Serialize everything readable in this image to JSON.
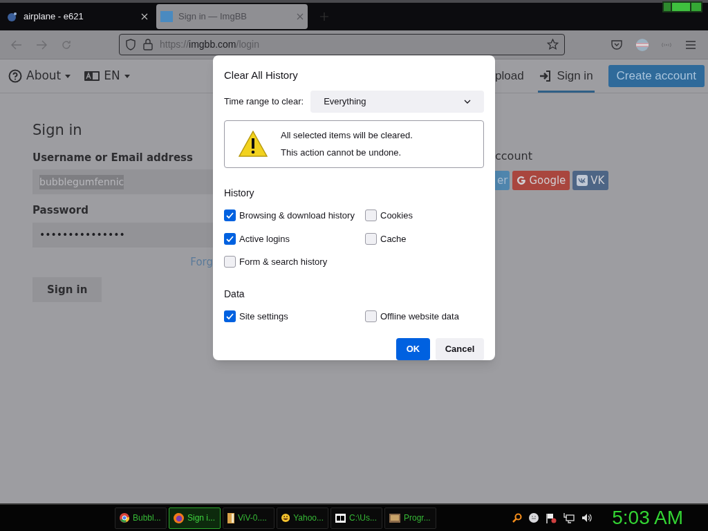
{
  "browser_tabs": [
    {
      "title": "airplane - e621",
      "selected": false
    },
    {
      "title": "Sign in — ImgBB",
      "selected": true
    }
  ],
  "address_bar": {
    "url_scheme": "https://",
    "url_domain": "imgbb.com",
    "url_path": "/login"
  },
  "site_header": {
    "menus": [
      {
        "label": "About"
      },
      {
        "label": "EN"
      }
    ],
    "links": [
      {
        "label": "pload",
        "selected": false
      },
      {
        "label": "Sign in",
        "selected": true
      }
    ],
    "create_account": "Create account"
  },
  "sign_in": {
    "title": "Sign in",
    "username_label": "Username or Email address",
    "username_value": "bubblegumfennic",
    "username_highlighted": true,
    "password_label": "Password",
    "password_value": "•••••••••••••••",
    "forgot_link": "Forg",
    "button": "Sign in"
  },
  "social": {
    "title": "ccount",
    "buttons": [
      {
        "label": "er",
        "color": "#4f85ad"
      },
      {
        "label": "Google",
        "color": "#a9463e"
      },
      {
        "label": "VK",
        "color": "#4d6585"
      }
    ]
  },
  "dialog": {
    "title": "Clear All History",
    "time_range_label": "Time range to clear:",
    "time_range_value": "Everything",
    "warning_lines": [
      "All selected items will be cleared.",
      "This action cannot be undone."
    ],
    "sections": [
      {
        "title": "History",
        "items": [
          {
            "label": "Browsing & download history",
            "checked": true
          },
          {
            "label": "Cookies",
            "checked": false
          },
          {
            "label": "Active logins",
            "checked": true
          },
          {
            "label": "Cache",
            "checked": false
          },
          {
            "label": "Form & search history",
            "checked": false
          }
        ]
      },
      {
        "title": "Data",
        "items": [
          {
            "label": "Site settings",
            "checked": true
          },
          {
            "label": "Offline website data",
            "checked": false
          }
        ]
      }
    ],
    "ok": "OK",
    "cancel": "Cancel"
  },
  "taskbar": {
    "items": [
      {
        "label": "Bubbl...",
        "selected": false
      },
      {
        "label": "Sign i...",
        "selected": true
      },
      {
        "label": "ViV-0....",
        "selected": false
      },
      {
        "label": "Yahoo...",
        "selected": false
      },
      {
        "label": "C:\\Us...",
        "selected": false
      },
      {
        "label": "Progr...",
        "selected": false
      }
    ],
    "clock": "5:03 AM"
  }
}
